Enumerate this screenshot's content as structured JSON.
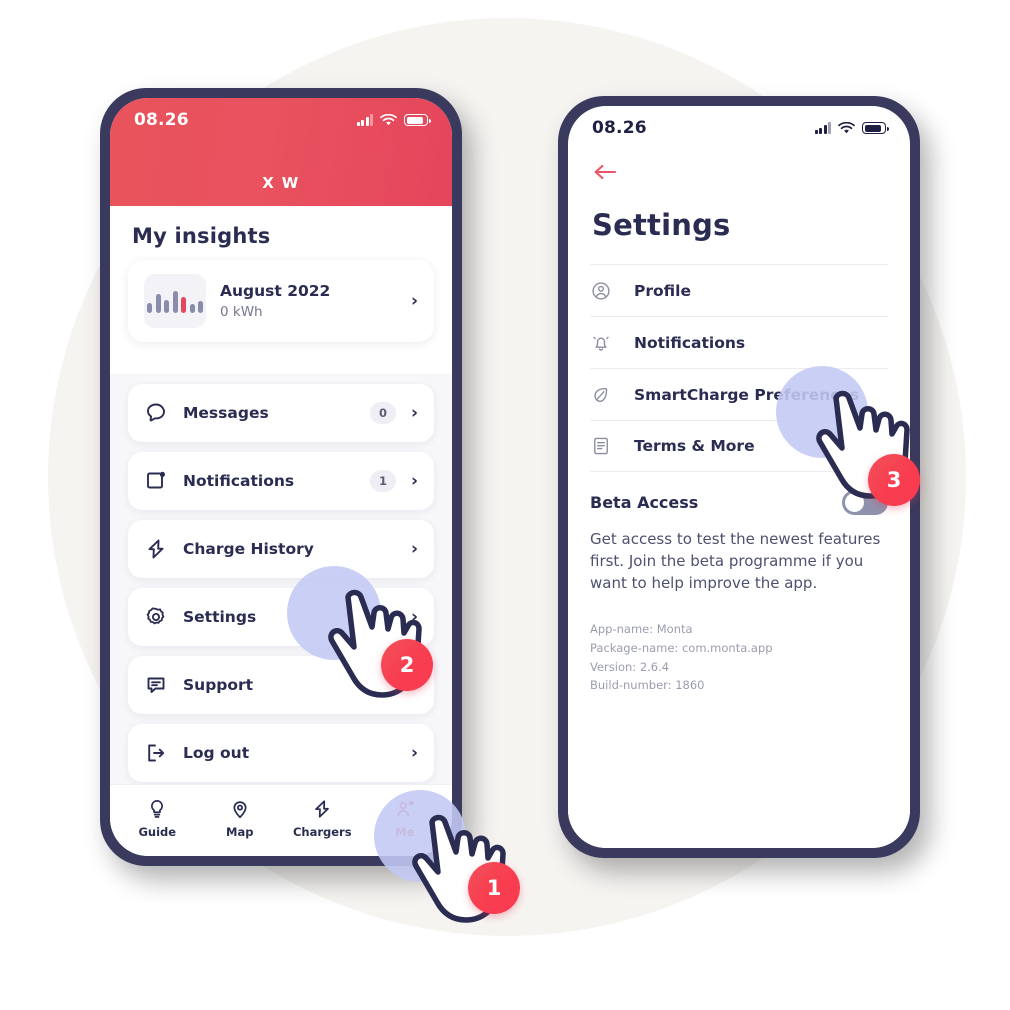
{
  "background": {
    "circle_color": "#f6f4f1",
    "page_color": "#ffffff"
  },
  "theme": {
    "brand_red": "#e4485c",
    "navy": "#2b2c52",
    "frame": "#393a5e",
    "highlight_blue": "#c3c9f4",
    "badge_red": "#f83d4f"
  },
  "phone_left": {
    "status_bar": {
      "time": "08.26",
      "signal_icon": "signal-bars-icon",
      "wifi_icon": "wifi-icon",
      "battery_icon": "battery-icon"
    },
    "header": {
      "title": "X W"
    },
    "section_title": "My insights",
    "insight_card": {
      "icon": "bar-chart-icon",
      "title": "August 2022",
      "subtitle": "0 kWh",
      "chevron": "›"
    },
    "menu": [
      {
        "icon": "message-icon",
        "label": "Messages",
        "badge": "0",
        "chevron": "›"
      },
      {
        "icon": "notification-icon",
        "label": "Notifications",
        "badge": "1",
        "chevron": "›"
      },
      {
        "icon": "bolt-icon",
        "label": "Charge History",
        "badge": null,
        "chevron": "›"
      },
      {
        "icon": "gear-icon",
        "label": "Settings",
        "badge": null,
        "chevron": "›"
      },
      {
        "icon": "support-icon",
        "label": "Support",
        "badge": null,
        "chevron": "›"
      },
      {
        "icon": "logout-icon",
        "label": "Log out",
        "badge": null,
        "chevron": "›"
      }
    ],
    "tabs": [
      {
        "icon": "bulb-icon",
        "label": "Guide",
        "active": false
      },
      {
        "icon": "pin-icon",
        "label": "Map",
        "active": false
      },
      {
        "icon": "bolt-icon",
        "label": "Chargers",
        "active": false
      },
      {
        "icon": "person-icon",
        "label": "Me",
        "active": true
      }
    ]
  },
  "phone_right": {
    "status_bar": {
      "time": "08.26",
      "signal_icon": "signal-bars-icon",
      "wifi_icon": "wifi-icon",
      "battery_icon": "battery-icon"
    },
    "back_icon": "back-arrow-icon",
    "page_title": "Settings",
    "items": [
      {
        "icon": "profile-icon",
        "label": "Profile"
      },
      {
        "icon": "bell-icon",
        "label": "Notifications"
      },
      {
        "icon": "leaf-icon",
        "label": "SmartCharge Preferences"
      },
      {
        "icon": "document-icon",
        "label": "Terms & More"
      }
    ],
    "beta": {
      "label": "Beta Access",
      "toggle_state": "off",
      "description": "Get access to test the newest features first. Join the beta programme if you want to help improve the app."
    },
    "app_info": {
      "app_name": "App-name: Monta",
      "package_name": "Package-name: com.monta.app",
      "version": "Version: 2.6.4",
      "build_number": "Build-number: 1860"
    }
  },
  "annotations": {
    "steps": [
      {
        "number": "1",
        "target": "tab-me"
      },
      {
        "number": "2",
        "target": "menu-settings"
      },
      {
        "number": "3",
        "target": "smartcharge-preferences"
      }
    ]
  }
}
